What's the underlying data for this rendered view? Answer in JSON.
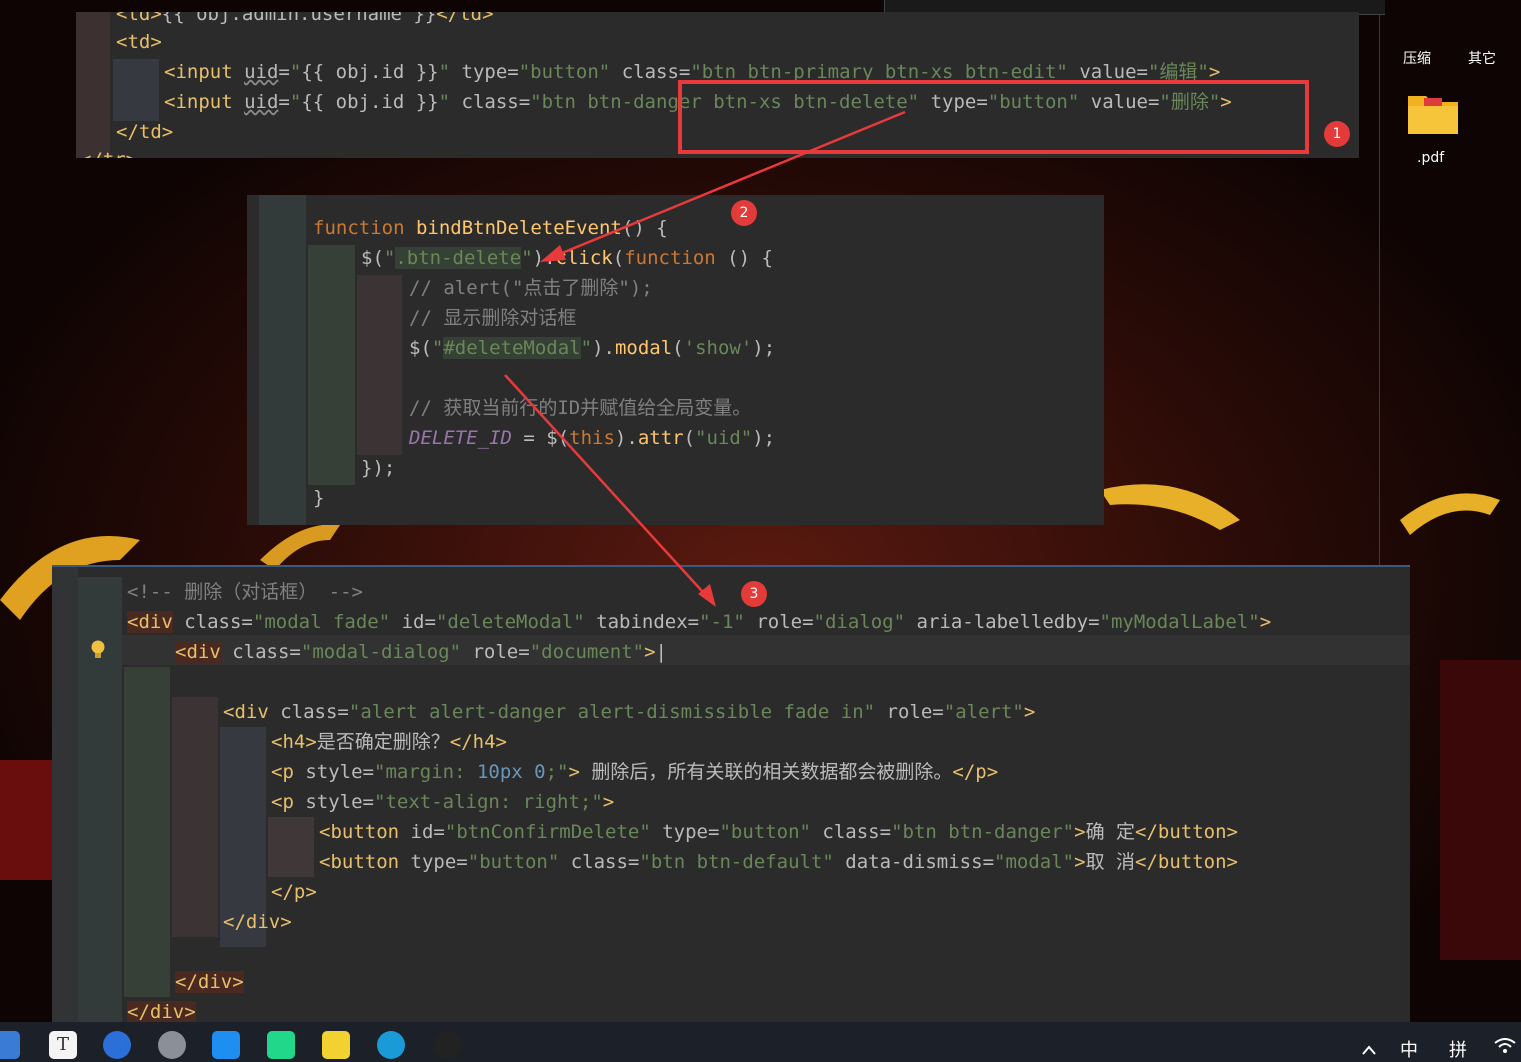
{
  "desktop": {
    "labels": {
      "compress": "压缩",
      "other": "其它"
    },
    "pdf_file": {
      "name": ".pdf"
    }
  },
  "panel1": {
    "lines": [
      "<td>{{ obj.admin.username }}</td>",
      "<td>",
      "<input uid=\"{{ obj.id }}\" type=\"button\" class=\"btn btn-primary btn-xs btn-edit\" value=\"编辑\">",
      "<input uid=\"{{ obj.id }}\" class=\"btn btn-danger btn-xs btn-delete\" type=\"button\" value=\"删除\">",
      "</td>",
      "</tr>"
    ]
  },
  "panel2": {
    "lines": [
      "function bindBtnDeleteEvent() {",
      "$(\".btn-delete\").click(function () {",
      "// alert(\"点击了删除\");",
      "// 显示删除对话框",
      "$(\"#deleteModal\").modal('show');",
      "// 获取当前行的ID并赋值给全局变量。",
      "DELETE_ID = $(this).attr(\"uid\");",
      "});",
      "}"
    ]
  },
  "panel3": {
    "lines": [
      "<!-- 删除（对话框） -->",
      "<div class=\"modal fade\" id=\"deleteModal\" tabindex=\"-1\" role=\"dialog\" aria-labelledby=\"myModalLabel\">",
      "<div class=\"modal-dialog\" role=\"document\">",
      "<div class=\"alert alert-danger alert-dismissible fade in\" role=\"alert\">",
      "<h4>是否确定删除？</h4>",
      "<p style=\"margin: 10px 0;\"> 删除后，所有关联的相关数据都会被删除。</p>",
      "<p style=\"text-align: right;\">",
      "<button id=\"btnConfirmDelete\" type=\"button\" class=\"btn btn-danger\">确 定</button>",
      "<button type=\"button\" class=\"btn btn-default\" data-dismiss=\"modal\">取 消</button>",
      "</p>",
      "</div>",
      "</div>",
      "</div>"
    ]
  },
  "annotations": {
    "badges": [
      "1",
      "2",
      "3"
    ]
  },
  "colors": {
    "annotation_red": "#e83a3a"
  },
  "taskbar": {
    "icons": [
      "explorer-icon",
      "typora-icon",
      "feishu-icon",
      "settings-icon",
      "xunlei-icon",
      "pycharm-icon",
      "potplayer-icon",
      "edge-icon",
      "qq-icon"
    ],
    "tray": {
      "lang": "中",
      "ime": "拼"
    }
  }
}
